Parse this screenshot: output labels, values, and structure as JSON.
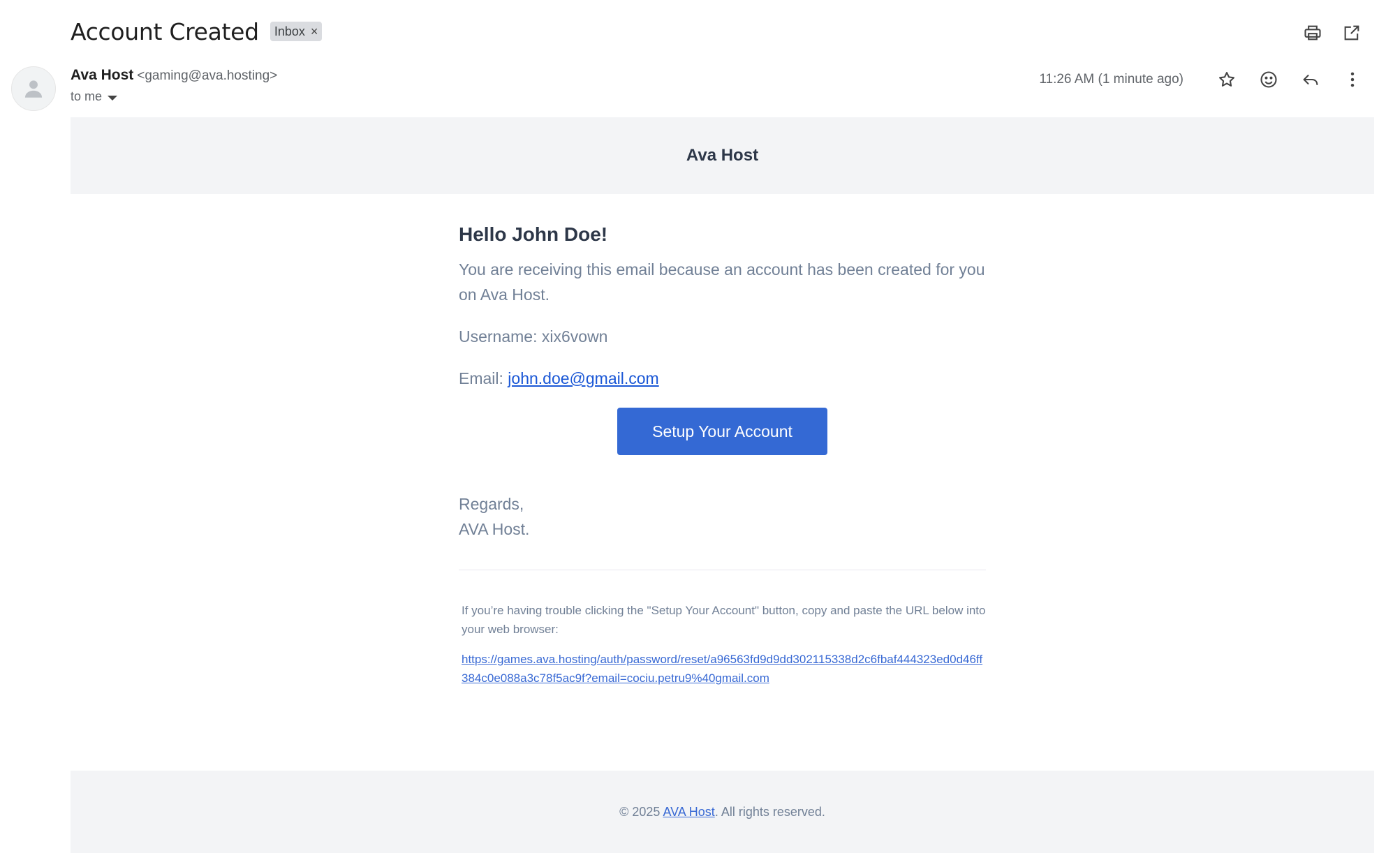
{
  "subject": "Account Created",
  "label_chip": {
    "text": "Inbox",
    "remove": "×"
  },
  "top_actions": [
    "print-icon",
    "open-in-new-window-icon"
  ],
  "sender": {
    "name": "Ava Host",
    "email": "<gaming@ava.hosting>",
    "to_label": "to me"
  },
  "meta": {
    "timestamp": "11:26 AM (1 minute ago)",
    "actions": [
      "star-icon",
      "emoji-icon",
      "reply-icon",
      "more-vert-icon"
    ]
  },
  "email": {
    "brand": "Ava Host",
    "greeting": "Hello John Doe!",
    "intro": "You are receiving this email because an account has been created for you on Ava Host.",
    "username_line": "Username: xix6vown",
    "email_label": "Email: ",
    "email_value": "john.doe@gmail.com",
    "cta_label": "Setup Your Account",
    "regards_line1": "Regards,",
    "regards_line2": "AVA Host.",
    "subcopy": "If you’re having trouble clicking the \"Setup Your Account\" button, copy and paste the URL below into your web browser:",
    "reset_url": "https://games.ava.hosting/auth/password/reset/a96563fd9d9dd302115338d2c6fbaf444323ed0d46ff384c0e088a3c78f5ac9f?email=cociu.petru9%40gmail.com",
    "footer_prefix": "© 2025 ",
    "footer_link": "AVA Host",
    "footer_suffix": ". All rights reserved."
  },
  "colors": {
    "band_bg": "#f3f4f6",
    "button_bg": "#3469d4",
    "link": "#3869d4",
    "muted_text": "#718096",
    "heading_text": "#2d3748"
  }
}
